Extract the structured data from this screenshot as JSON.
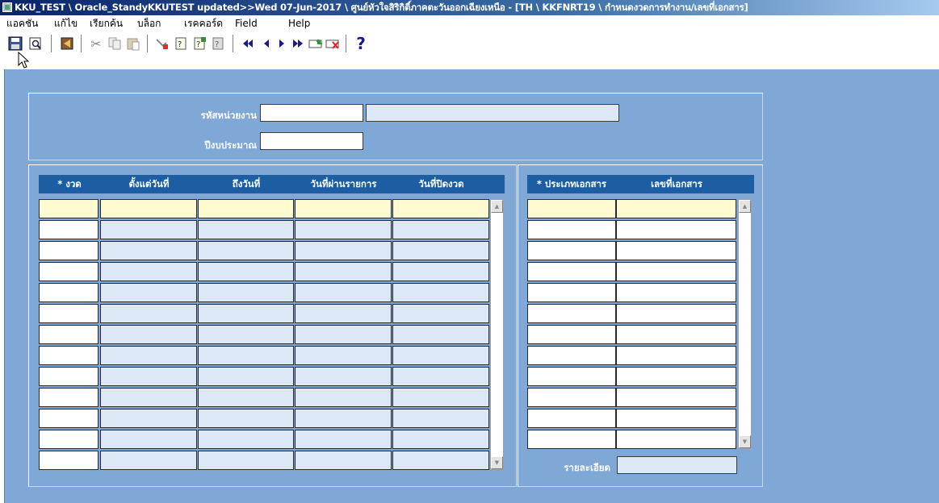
{
  "window": {
    "title": "KKU_TEST \\ Oracle_StandyKKUTEST updated>>Wed 07-Jun-2017 \\ ศูนย์หัวใจสิริกิติ์ภาคตะวันออกเฉียงเหนือ - [TH \\ KKFNRT19 \\ กำหนดงวดการทำงาน/เลขที่เอกสาร]"
  },
  "menu": {
    "items": [
      "แอคชัน",
      "แก้ไข",
      "เรียกค้น",
      "บล็อก",
      "เรคคอร์ด",
      "Field",
      "Help"
    ]
  },
  "toolbar": {
    "icons": [
      "save-icon",
      "print-preview-icon",
      "exit-icon",
      "cut-icon",
      "copy-icon",
      "paste-icon",
      "clear-icon",
      "query-enter-icon",
      "query-execute-icon",
      "query-count-icon",
      "first-record-icon",
      "previous-record-icon",
      "next-record-icon",
      "last-record-icon",
      "insert-record-icon",
      "delete-record-icon",
      "help-icon"
    ],
    "help_glyph": "?"
  },
  "form": {
    "unit_code_label": "รหัสหน่วยงาน",
    "fiscal_year_label": "ปีงบประมาณ",
    "unit_code_value": "",
    "unit_name_value": "",
    "fiscal_year_value": ""
  },
  "periods_table": {
    "columns": [
      "* งวด",
      "ตั้งแต่วันที่",
      "ถึงวันที่",
      "วันที่ผ่านรายการ",
      "วันที่ปิดงวด"
    ],
    "row_count": 13
  },
  "documents_table": {
    "columns": [
      "* ประเภทเอกสาร",
      "เลขที่เอกสาร"
    ],
    "row_count": 12,
    "detail_label": "รายละเอียด",
    "detail_value": ""
  },
  "colors": {
    "workspace": "#7fa8d6",
    "header": "#1c5ea1",
    "current_row": "#fffad0",
    "field_blue": "#dde8f6"
  }
}
